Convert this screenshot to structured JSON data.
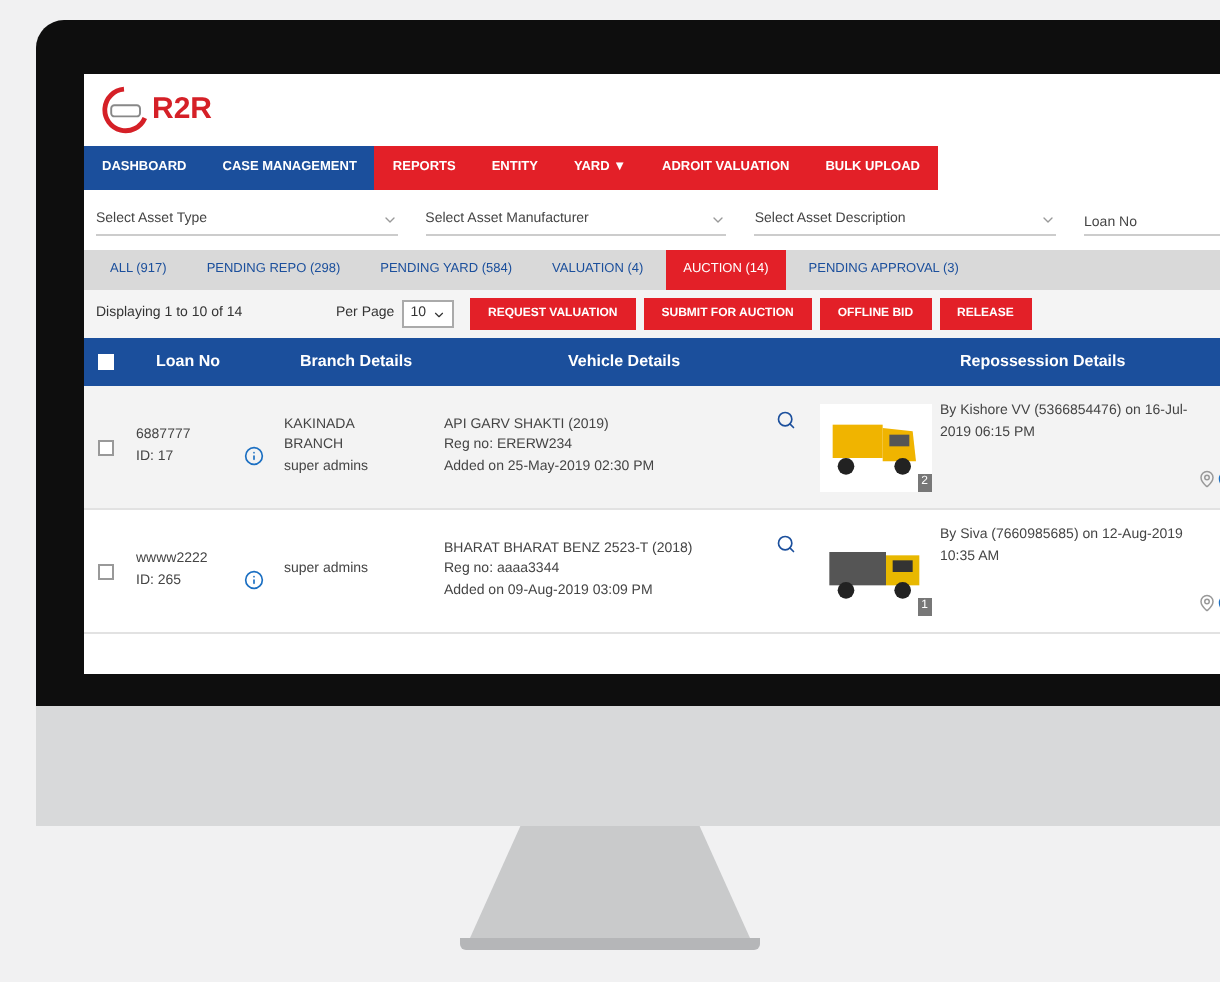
{
  "logo": {
    "text": "R2R"
  },
  "nav": [
    {
      "label": "DASHBOARD",
      "color": "#1b4f9c"
    },
    {
      "label": "CASE MANAGEMENT",
      "color": "#1b4f9c"
    },
    {
      "label": "REPORTS",
      "color": "#e32028"
    },
    {
      "label": "ENTITY",
      "color": "#e32028"
    },
    {
      "label": "YARD ▼",
      "color": "#e32028"
    },
    {
      "label": "ADROIT VALUATION",
      "color": "#e32028"
    },
    {
      "label": "BULK UPLOAD",
      "color": "#e32028"
    }
  ],
  "filters": [
    {
      "kind": "select",
      "label": "Select Asset Type"
    },
    {
      "kind": "select",
      "label": "Select Asset Manufacturer"
    },
    {
      "kind": "select",
      "label": "Select Asset Description"
    },
    {
      "kind": "input",
      "placeholder": "Loan No"
    }
  ],
  "tabs": [
    {
      "label": "ALL (917)",
      "selected": false
    },
    {
      "label": "PENDING REPO (298)",
      "selected": false
    },
    {
      "label": "PENDING YARD (584)",
      "selected": false
    },
    {
      "label": "VALUATION (4)",
      "selected": false
    },
    {
      "label": "AUCTION (14)",
      "selected": true
    },
    {
      "label": "PENDING APPROVAL (3)",
      "selected": false
    }
  ],
  "toolbar": {
    "summary": "Displaying 1 to 10 of 14",
    "per_page_label": "Per Page",
    "per_page": "10",
    "buttons": [
      "REQUEST VALUATION",
      "SUBMIT FOR AUCTION",
      "OFFLINE BID",
      "RELEASE"
    ]
  },
  "table": {
    "select_all": false,
    "columns": [
      "Loan No",
      "Branch Details",
      "Vehicle Details",
      "Repossession Details"
    ],
    "rows": [
      {
        "checked": false,
        "loan_no": "6887777",
        "id": "ID: 17",
        "branch": "KAKINADA BRANCH",
        "user": "super admins",
        "vehicle": "API GARV SHAKTI (2019)",
        "reg": "Reg no: ERERW234",
        "added": "Added on 25-May-2019 02:30 PM",
        "photo_count": "2",
        "kind": "auto",
        "repossession": "By Kishore VV (5366854476) on 16-Jul-2019 06:15 PM"
      },
      {
        "checked": false,
        "loan_no": "wwww2222",
        "id": "ID: 265",
        "user": "super admins",
        "vehicle": "BHARAT BHARAT BENZ 2523-T (2018)",
        "reg": "Reg no: aaaa3344",
        "added": "Added on 09-Aug-2019 03:09 PM",
        "photo_count": "1",
        "kind": "truck",
        "repossession": "By Siva (7660985685) on 12-Aug-2019 10:35 AM"
      }
    ]
  }
}
